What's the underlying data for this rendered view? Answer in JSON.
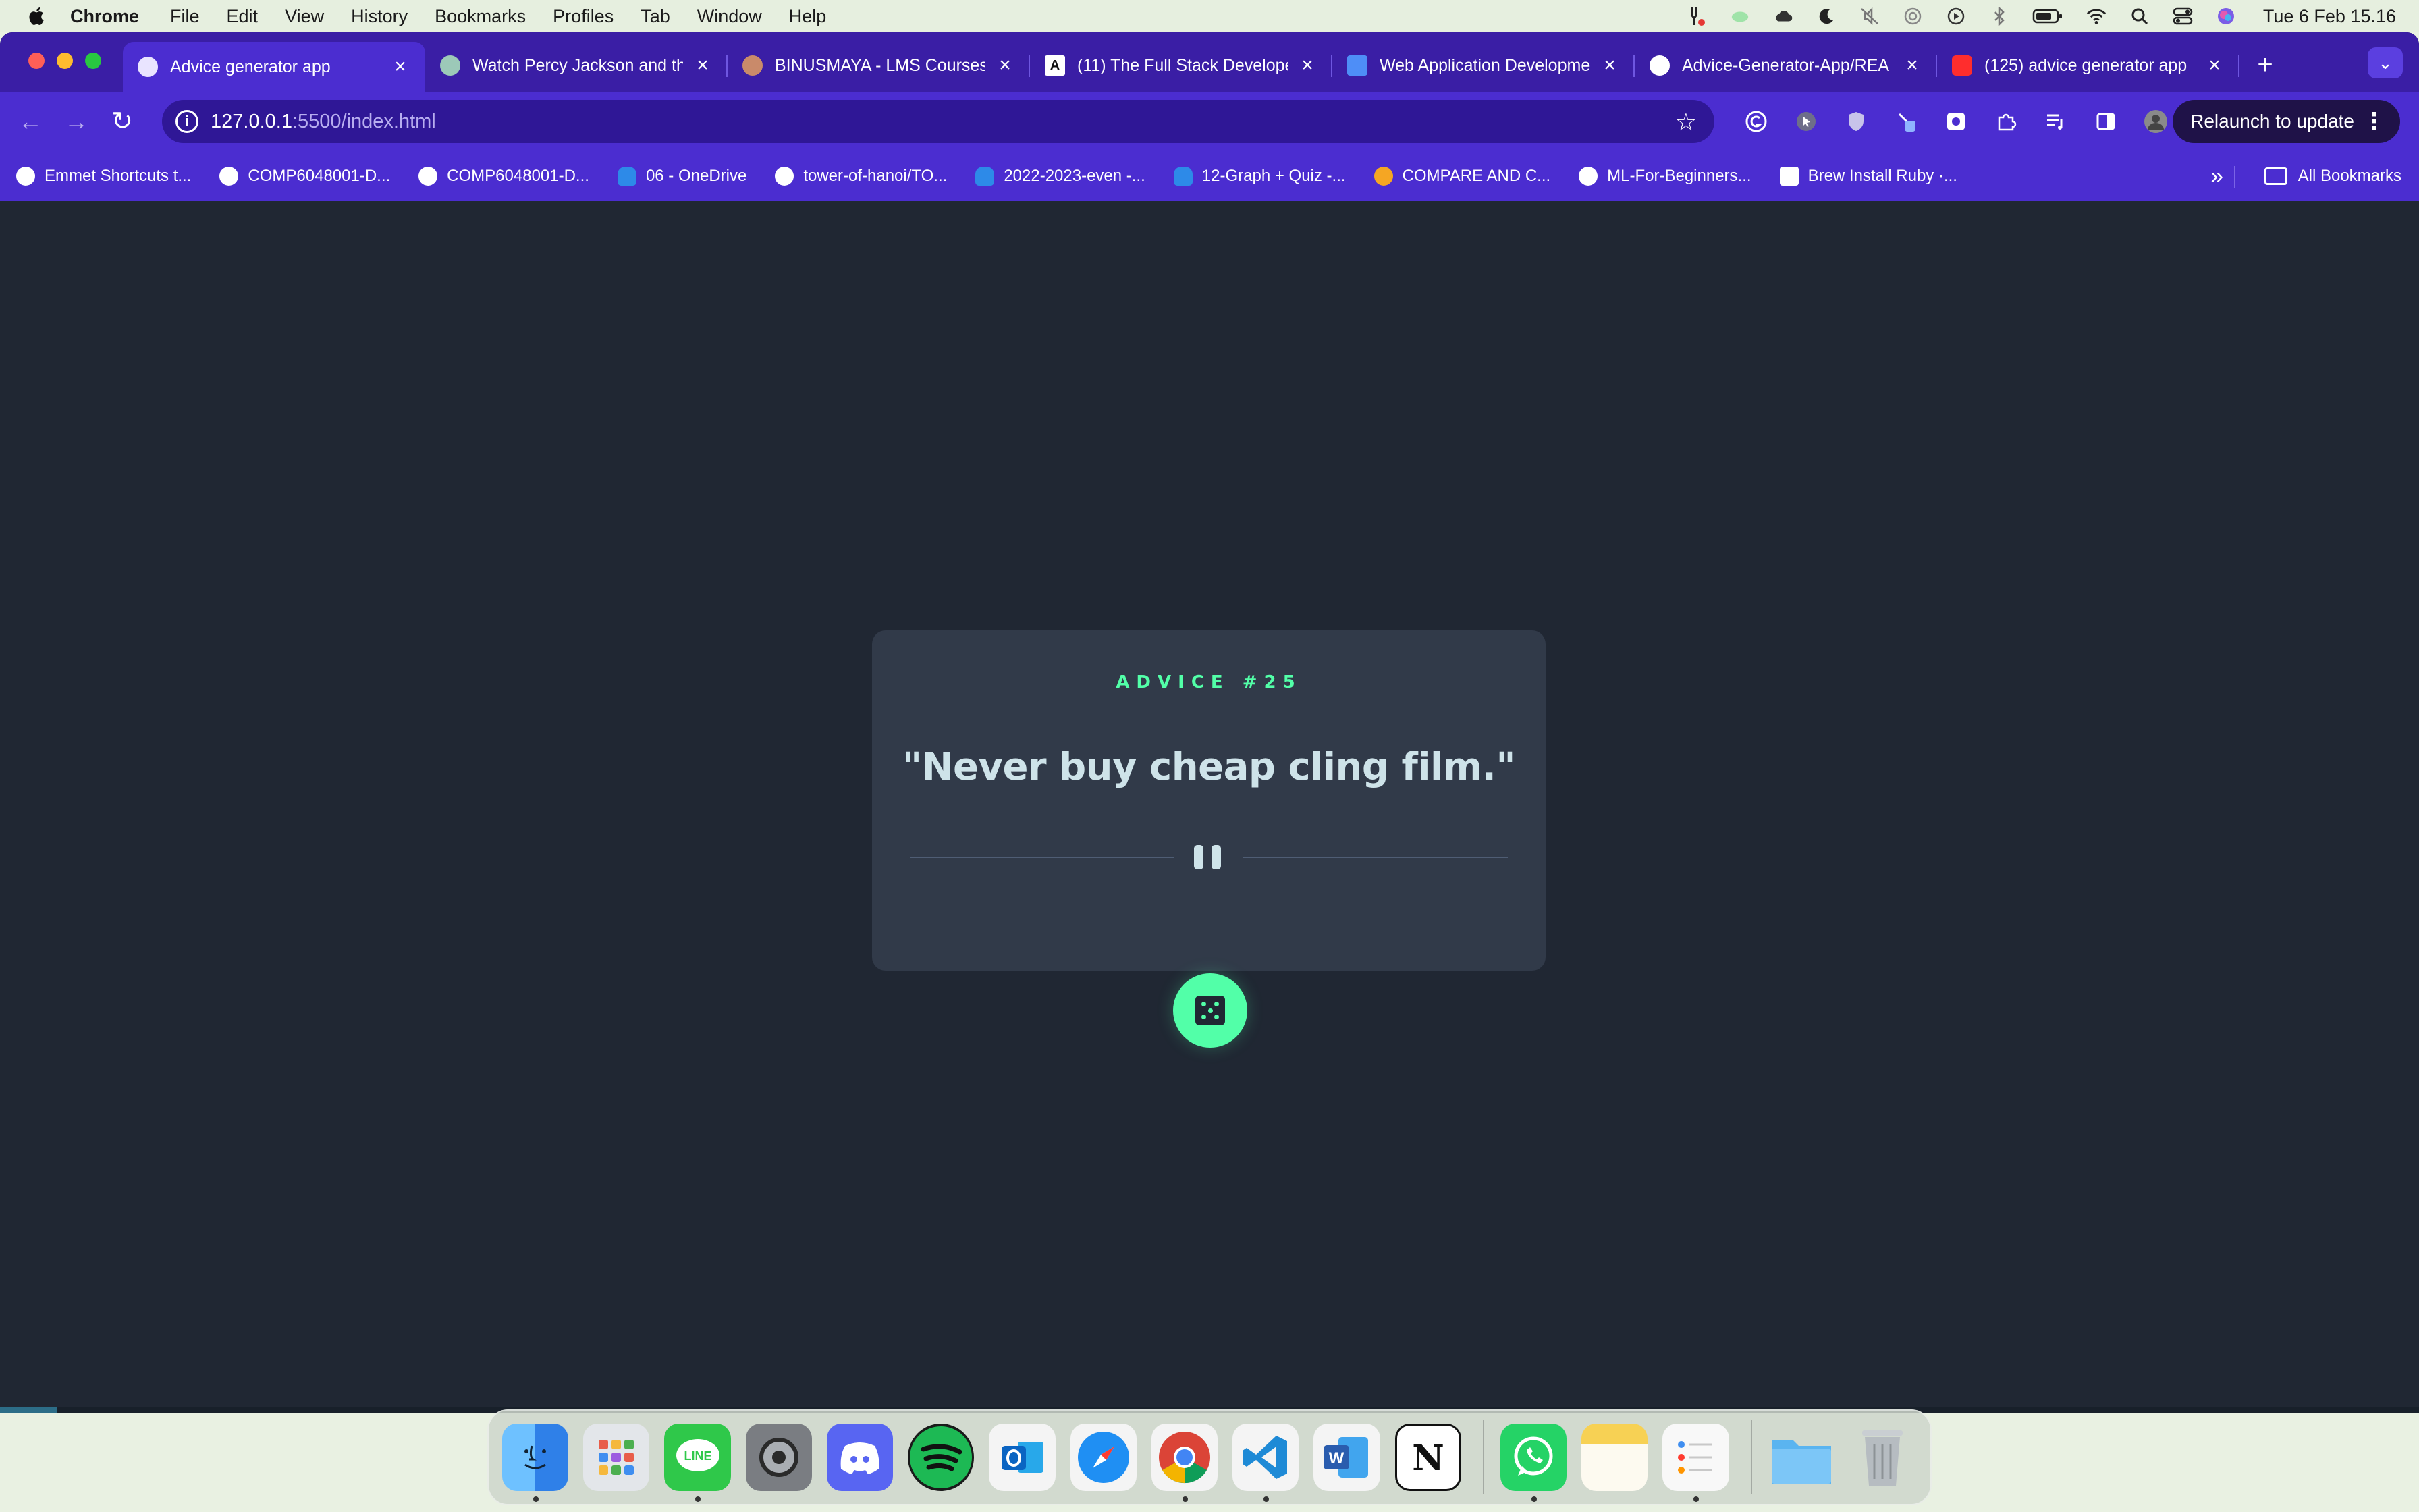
{
  "menubar": {
    "app_name": "Chrome",
    "menus": [
      "File",
      "Edit",
      "View",
      "History",
      "Bookmarks",
      "Profiles",
      "Tab",
      "Window",
      "Help"
    ],
    "status_icons": [
      "tool-icon",
      "cloud-green-icon",
      "cloud-icon",
      "moon-icon",
      "mic-off-icon",
      "airdrop-icon",
      "play-icon",
      "bluetooth-icon",
      "battery-icon",
      "wifi-icon",
      "search-icon",
      "control-center-icon",
      "siri-icon"
    ],
    "clock": "Tue 6 Feb  15.16"
  },
  "browser": {
    "tabs": [
      {
        "title": "Advice generator app",
        "favicon": "globe-icon",
        "active": true,
        "favicon_color": "#e9e4ff"
      },
      {
        "title": "Watch Percy Jackson and the",
        "favicon": "globe-icon",
        "active": false,
        "favicon_color": "#9cc9b8"
      },
      {
        "title": "BINUSMAYA - LMS Courses",
        "favicon": "eye-icon",
        "active": false,
        "favicon_color": "#c98a6a"
      },
      {
        "title": "(11) The Full Stack Develope",
        "favicon": "medium-icon",
        "active": false,
        "favicon_color": "#ffffff"
      },
      {
        "title": "Web Application Developme",
        "favicon": "docs-icon",
        "active": false,
        "favicon_color": "#4e8ef7"
      },
      {
        "title": "Advice-Generator-App/REA",
        "favicon": "github-icon",
        "active": false,
        "favicon_color": "#ffffff"
      },
      {
        "title": "(125) advice generator app",
        "favicon": "youtube-icon",
        "active": false,
        "favicon_color": "#ff2d2d"
      }
    ],
    "new_tab_label": "+",
    "url_host": "127.0.0.1",
    "url_path": ":5500/index.html",
    "relaunch_label": "Relaunch to update",
    "bookmarks": [
      {
        "label": "Emmet Shortcuts t...",
        "icon": "globe-icon"
      },
      {
        "label": "COMP6048001-D...",
        "icon": "globe-icon"
      },
      {
        "label": "COMP6048001-D...",
        "icon": "globe-icon"
      },
      {
        "label": "06 - OneDrive",
        "icon": "onedrive-icon"
      },
      {
        "label": "tower-of-hanoi/TO...",
        "icon": "github-icon"
      },
      {
        "label": "2022-2023-even -...",
        "icon": "onedrive-icon"
      },
      {
        "label": "12-Graph + Quiz -...",
        "icon": "onedrive-icon"
      },
      {
        "label": "COMPARE AND C...",
        "icon": "colab-icon"
      },
      {
        "label": "ML-For-Beginners...",
        "icon": "globe-icon"
      },
      {
        "label": "Brew Install Ruby ·...",
        "icon": "page-icon"
      }
    ],
    "all_bookmarks_label": "All Bookmarks"
  },
  "advice": {
    "id_label": "ADVICE #25",
    "text": "\"Never buy cheap cling film.\""
  },
  "colors": {
    "accent_green": "#52ffa8",
    "card_bg": "#313a49",
    "page_bg": "#202733",
    "text_light": "#cee3e9",
    "chrome_purple": "#4b2dd0"
  },
  "dock": {
    "apps": [
      {
        "name": "finder-icon",
        "color": "#3d8ff0",
        "running": true
      },
      {
        "name": "launchpad-icon",
        "color": "#dfe3e8",
        "running": false
      },
      {
        "name": "line-icon",
        "color": "#2fc84a",
        "running": true
      },
      {
        "name": "system-settings-icon",
        "color": "#7a7d82",
        "running": false
      },
      {
        "name": "discord-icon",
        "color": "#5865f2",
        "running": false
      },
      {
        "name": "spotify-icon",
        "color": "#1db954",
        "running": false
      },
      {
        "name": "outlook-icon",
        "color": "#1a73c7",
        "running": false
      },
      {
        "name": "safari-icon",
        "color": "#1f8ff3",
        "running": false
      },
      {
        "name": "chrome-icon",
        "color": "#f1f1f1",
        "running": true
      },
      {
        "name": "vscode-icon",
        "color": "#1e8ad6",
        "running": true
      },
      {
        "name": "word-icon",
        "color": "#2a5cae",
        "running": false
      },
      {
        "name": "notion-icon",
        "color": "#ffffff",
        "running": false
      },
      {
        "name": "whatsapp-icon",
        "color": "#25d366",
        "running": true
      },
      {
        "name": "notes-icon",
        "color": "#f7d154",
        "running": false
      },
      {
        "name": "reminders-icon",
        "color": "#f4f4f4",
        "running": true
      },
      {
        "name": "downloads-folder-icon",
        "color": "#5ab4f0",
        "running": false
      },
      {
        "name": "trash-icon",
        "color": "#b6bcc1",
        "running": false
      }
    ]
  }
}
